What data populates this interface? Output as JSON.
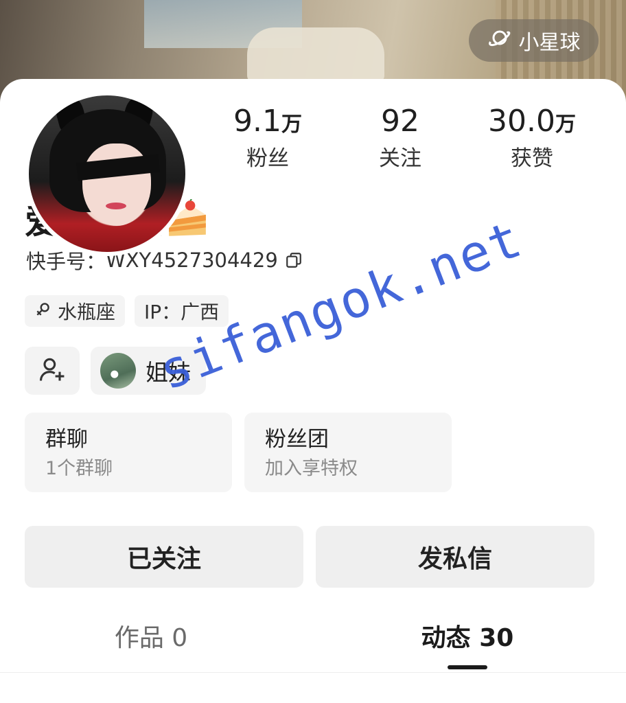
{
  "header": {
    "planet_button_label": "小星球",
    "planet_icon": "planet-icon"
  },
  "profile": {
    "nickname": "爱吃蛋糕",
    "nickname_emoji": "cake-slice-icon",
    "kuaishou_id_label": "快手号：",
    "kuaishou_id": "WXY4527304429"
  },
  "stats": [
    {
      "value": "9.1",
      "unit": "万",
      "label": "粉丝"
    },
    {
      "value": "92",
      "unit": "",
      "label": "关注"
    },
    {
      "value": "30.0",
      "unit": "万",
      "label": "获赞"
    }
  ],
  "tags": [
    {
      "icon": "female-symbol-icon",
      "label": "水瓶座"
    },
    {
      "icon": "",
      "label": "IP：广西"
    }
  ],
  "social": {
    "add_friend_icon": "add-user-icon",
    "relation_label": "姐妹"
  },
  "cards": [
    {
      "title": "群聊",
      "sub": "1个群聊"
    },
    {
      "title": "粉丝团",
      "sub": "加入享特权"
    }
  ],
  "actions": {
    "follow_label": "已关注",
    "message_label": "发私信"
  },
  "tabs": [
    {
      "label": "作品 0"
    },
    {
      "label": "动态 30"
    }
  ],
  "overlay": {
    "watermark_text": "sifangok.net"
  },
  "colors": {
    "watermark": "#3a5fd8",
    "button_bg": "#efefef",
    "text_primary": "#1f1f1f"
  }
}
